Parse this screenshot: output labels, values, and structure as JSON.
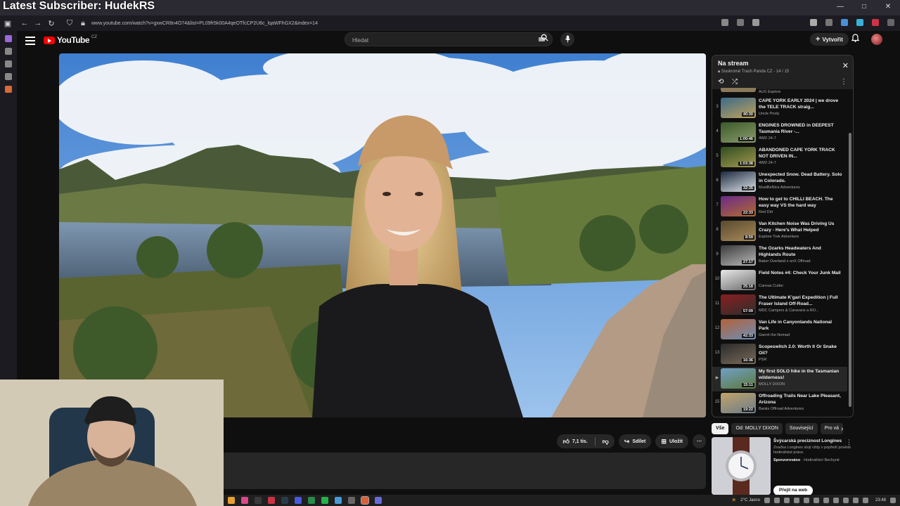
{
  "overlay": {
    "title": "Latest Subscriber: HudekRS"
  },
  "browser": {
    "url": "www.youtube.com/watch?v=gxwCR8n4O74&list=PL09fr5k00A4qeOTfcCP2U6c_lqaWFhGX2&index=14"
  },
  "header": {
    "logo_text": "YouTube",
    "logo_country": "CZ",
    "search_placeholder": "Hledat",
    "create_label": "Vytvořit"
  },
  "actions": {
    "like_count": "7,1 tis.",
    "share_label": "Sdílet",
    "save_label": "Uložit"
  },
  "playlist": {
    "title": "Na stream",
    "subtitle": "Soukromé Trash Panda CZ - 14 / 15",
    "partial_channel": "AUS Explore",
    "items": [
      {
        "num": "3",
        "title": "CAPE YORK EARLY 2024 | we drove the TELE TRACK straig...",
        "channel": "Uncle Pooly",
        "duration": "40:30",
        "c1": "#3a6b8a",
        "c2": "#c2a15a",
        "current": false
      },
      {
        "num": "4",
        "title": "ENGINES DROWNED in DEEPEST Tasmania River -...",
        "channel": "4WD 24-7",
        "duration": "1:00:46",
        "c1": "#3c5a2a",
        "c2": "#8a9b6b",
        "current": false
      },
      {
        "num": "5",
        "title": "ABANDONED CAPE YORK TRACK NOT DRIVEN IN...",
        "channel": "4WD 24-7",
        "duration": "1:03:38",
        "c1": "#2f4d1e",
        "c2": "#a59a52",
        "current": false
      },
      {
        "num": "6",
        "title": "Unexpected Snow. Dead Battery. Solo in Colorado.",
        "channel": "MustBeNice Adventures",
        "duration": "32:35",
        "c1": "#1d2b40",
        "c2": "#dfe4ea",
        "current": false
      },
      {
        "num": "7",
        "title": "How to get to CHILLI BEACH. The easy way VS the hard way",
        "channel": "Red Dirt",
        "duration": "22:33",
        "c1": "#6a2a8a",
        "c2": "#b36b2f",
        "current": false
      },
      {
        "num": "8",
        "title": "Van Kitchen Noise Was Driving Us Crazy - Here's What Helped",
        "channel": "Explore Trek Adventure",
        "duration": "8:59",
        "c1": "#5a4a2e",
        "c2": "#a88a5a",
        "current": false
      },
      {
        "num": "9",
        "title": "The Ozarks Headwaters And Highlands Route",
        "channel": "Baker Overland x onX Offroad",
        "duration": "27:17",
        "c1": "#3b3b3b",
        "c2": "#b9b9b9",
        "current": false
      },
      {
        "num": "10",
        "title": "Field Notes #4: Check Your Junk Mail",
        "channel": "Canvas Cutter",
        "duration": "25:18",
        "c1": "#e8e8e8",
        "c2": "#6a6a6a",
        "current": false
      },
      {
        "num": "11",
        "title": "The Ultimate K'gari Expedition | Full Fraser Island Off-Road...",
        "channel": "MDC Campers & Caravans a RO...",
        "duration": "57:09",
        "c1": "#8a1e1e",
        "c2": "#2e2e2e",
        "current": false
      },
      {
        "num": "12",
        "title": "Van Life in Canyonlands National Park",
        "channel": "Garret the Nomad",
        "duration": "42:33",
        "c1": "#b5603a",
        "c2": "#6b8fb8",
        "current": false
      },
      {
        "num": "13",
        "title": "Scopeswitch 2.0: Worth It Or Snake Oil?",
        "channel": "PSR",
        "duration": "16:36",
        "c1": "#2a2a2a",
        "c2": "#7a6b5a",
        "current": false
      },
      {
        "num": "▶",
        "title": "My first SOLO hike in the Tasmanian wilderness!",
        "channel": "MOLLY DIXON",
        "duration": "15:11",
        "c1": "#6fa0c8",
        "c2": "#5d7a3a",
        "current": true
      },
      {
        "num": "15",
        "title": "Offroading Trails Near Lake Pleasant, Arizona",
        "channel": "Banks Offroad Adventures",
        "duration": "19:22",
        "c1": "#c2a36a",
        "c2": "#6a7d8a",
        "current": false
      }
    ]
  },
  "chips": [
    {
      "label": "Vše",
      "active": true
    },
    {
      "label": "Od: MOLLY DIXON",
      "active": false
    },
    {
      "label": "Související",
      "active": false
    },
    {
      "label": "Pro vá",
      "active": false
    }
  ],
  "ad": {
    "title": "Švýcarská preciznost Longines",
    "desc": "Značka Longines stojí vždy v popředí pověsti hodinářské práce.",
    "sponsored_label": "Sponzorováno",
    "sponsor": "· Hodinářství Bechyně",
    "cta": "Přejít na web"
  },
  "taskbar": {
    "weather": "2°C  Jasno",
    "time": "23:48"
  },
  "colors": {
    "accent": "#ff0000",
    "bg": "#0f0f0f",
    "surface": "#272727"
  }
}
